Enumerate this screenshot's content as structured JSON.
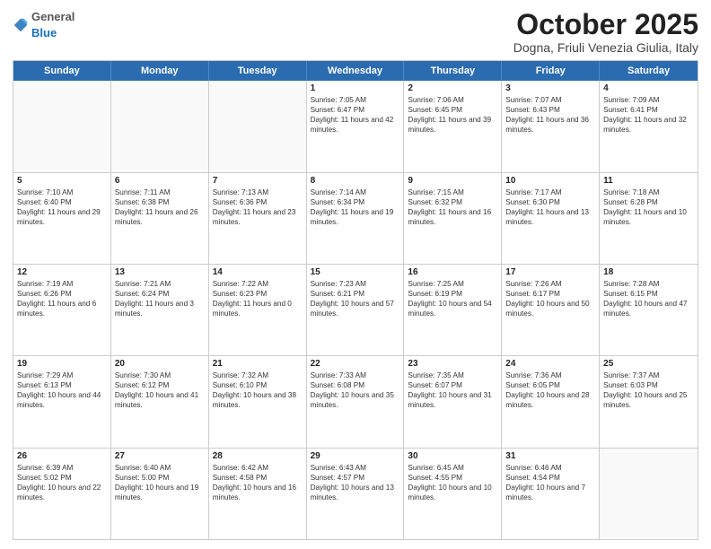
{
  "header": {
    "logo_general": "General",
    "logo_blue": "Blue",
    "month_title": "October 2025",
    "location": "Dogna, Friuli Venezia Giulia, Italy"
  },
  "days_of_week": [
    "Sunday",
    "Monday",
    "Tuesday",
    "Wednesday",
    "Thursday",
    "Friday",
    "Saturday"
  ],
  "weeks": [
    [
      {
        "day": "",
        "info": ""
      },
      {
        "day": "",
        "info": ""
      },
      {
        "day": "",
        "info": ""
      },
      {
        "day": "1",
        "info": "Sunrise: 7:05 AM\nSunset: 6:47 PM\nDaylight: 11 hours and 42 minutes."
      },
      {
        "day": "2",
        "info": "Sunrise: 7:06 AM\nSunset: 6:45 PM\nDaylight: 11 hours and 39 minutes."
      },
      {
        "day": "3",
        "info": "Sunrise: 7:07 AM\nSunset: 6:43 PM\nDaylight: 11 hours and 36 minutes."
      },
      {
        "day": "4",
        "info": "Sunrise: 7:09 AM\nSunset: 6:41 PM\nDaylight: 11 hours and 32 minutes."
      }
    ],
    [
      {
        "day": "5",
        "info": "Sunrise: 7:10 AM\nSunset: 6:40 PM\nDaylight: 11 hours and 29 minutes."
      },
      {
        "day": "6",
        "info": "Sunrise: 7:11 AM\nSunset: 6:38 PM\nDaylight: 11 hours and 26 minutes."
      },
      {
        "day": "7",
        "info": "Sunrise: 7:13 AM\nSunset: 6:36 PM\nDaylight: 11 hours and 23 minutes."
      },
      {
        "day": "8",
        "info": "Sunrise: 7:14 AM\nSunset: 6:34 PM\nDaylight: 11 hours and 19 minutes."
      },
      {
        "day": "9",
        "info": "Sunrise: 7:15 AM\nSunset: 6:32 PM\nDaylight: 11 hours and 16 minutes."
      },
      {
        "day": "10",
        "info": "Sunrise: 7:17 AM\nSunset: 6:30 PM\nDaylight: 11 hours and 13 minutes."
      },
      {
        "day": "11",
        "info": "Sunrise: 7:18 AM\nSunset: 6:28 PM\nDaylight: 11 hours and 10 minutes."
      }
    ],
    [
      {
        "day": "12",
        "info": "Sunrise: 7:19 AM\nSunset: 6:26 PM\nDaylight: 11 hours and 6 minutes."
      },
      {
        "day": "13",
        "info": "Sunrise: 7:21 AM\nSunset: 6:24 PM\nDaylight: 11 hours and 3 minutes."
      },
      {
        "day": "14",
        "info": "Sunrise: 7:22 AM\nSunset: 6:23 PM\nDaylight: 11 hours and 0 minutes."
      },
      {
        "day": "15",
        "info": "Sunrise: 7:23 AM\nSunset: 6:21 PM\nDaylight: 10 hours and 57 minutes."
      },
      {
        "day": "16",
        "info": "Sunrise: 7:25 AM\nSunset: 6:19 PM\nDaylight: 10 hours and 54 minutes."
      },
      {
        "day": "17",
        "info": "Sunrise: 7:26 AM\nSunset: 6:17 PM\nDaylight: 10 hours and 50 minutes."
      },
      {
        "day": "18",
        "info": "Sunrise: 7:28 AM\nSunset: 6:15 PM\nDaylight: 10 hours and 47 minutes."
      }
    ],
    [
      {
        "day": "19",
        "info": "Sunrise: 7:29 AM\nSunset: 6:13 PM\nDaylight: 10 hours and 44 minutes."
      },
      {
        "day": "20",
        "info": "Sunrise: 7:30 AM\nSunset: 6:12 PM\nDaylight: 10 hours and 41 minutes."
      },
      {
        "day": "21",
        "info": "Sunrise: 7:32 AM\nSunset: 6:10 PM\nDaylight: 10 hours and 38 minutes."
      },
      {
        "day": "22",
        "info": "Sunrise: 7:33 AM\nSunset: 6:08 PM\nDaylight: 10 hours and 35 minutes."
      },
      {
        "day": "23",
        "info": "Sunrise: 7:35 AM\nSunset: 6:07 PM\nDaylight: 10 hours and 31 minutes."
      },
      {
        "day": "24",
        "info": "Sunrise: 7:36 AM\nSunset: 6:05 PM\nDaylight: 10 hours and 28 minutes."
      },
      {
        "day": "25",
        "info": "Sunrise: 7:37 AM\nSunset: 6:03 PM\nDaylight: 10 hours and 25 minutes."
      }
    ],
    [
      {
        "day": "26",
        "info": "Sunrise: 6:39 AM\nSunset: 5:02 PM\nDaylight: 10 hours and 22 minutes."
      },
      {
        "day": "27",
        "info": "Sunrise: 6:40 AM\nSunset: 5:00 PM\nDaylight: 10 hours and 19 minutes."
      },
      {
        "day": "28",
        "info": "Sunrise: 6:42 AM\nSunset: 4:58 PM\nDaylight: 10 hours and 16 minutes."
      },
      {
        "day": "29",
        "info": "Sunrise: 6:43 AM\nSunset: 4:57 PM\nDaylight: 10 hours and 13 minutes."
      },
      {
        "day": "30",
        "info": "Sunrise: 6:45 AM\nSunset: 4:55 PM\nDaylight: 10 hours and 10 minutes."
      },
      {
        "day": "31",
        "info": "Sunrise: 6:46 AM\nSunset: 4:54 PM\nDaylight: 10 hours and 7 minutes."
      },
      {
        "day": "",
        "info": ""
      }
    ]
  ]
}
